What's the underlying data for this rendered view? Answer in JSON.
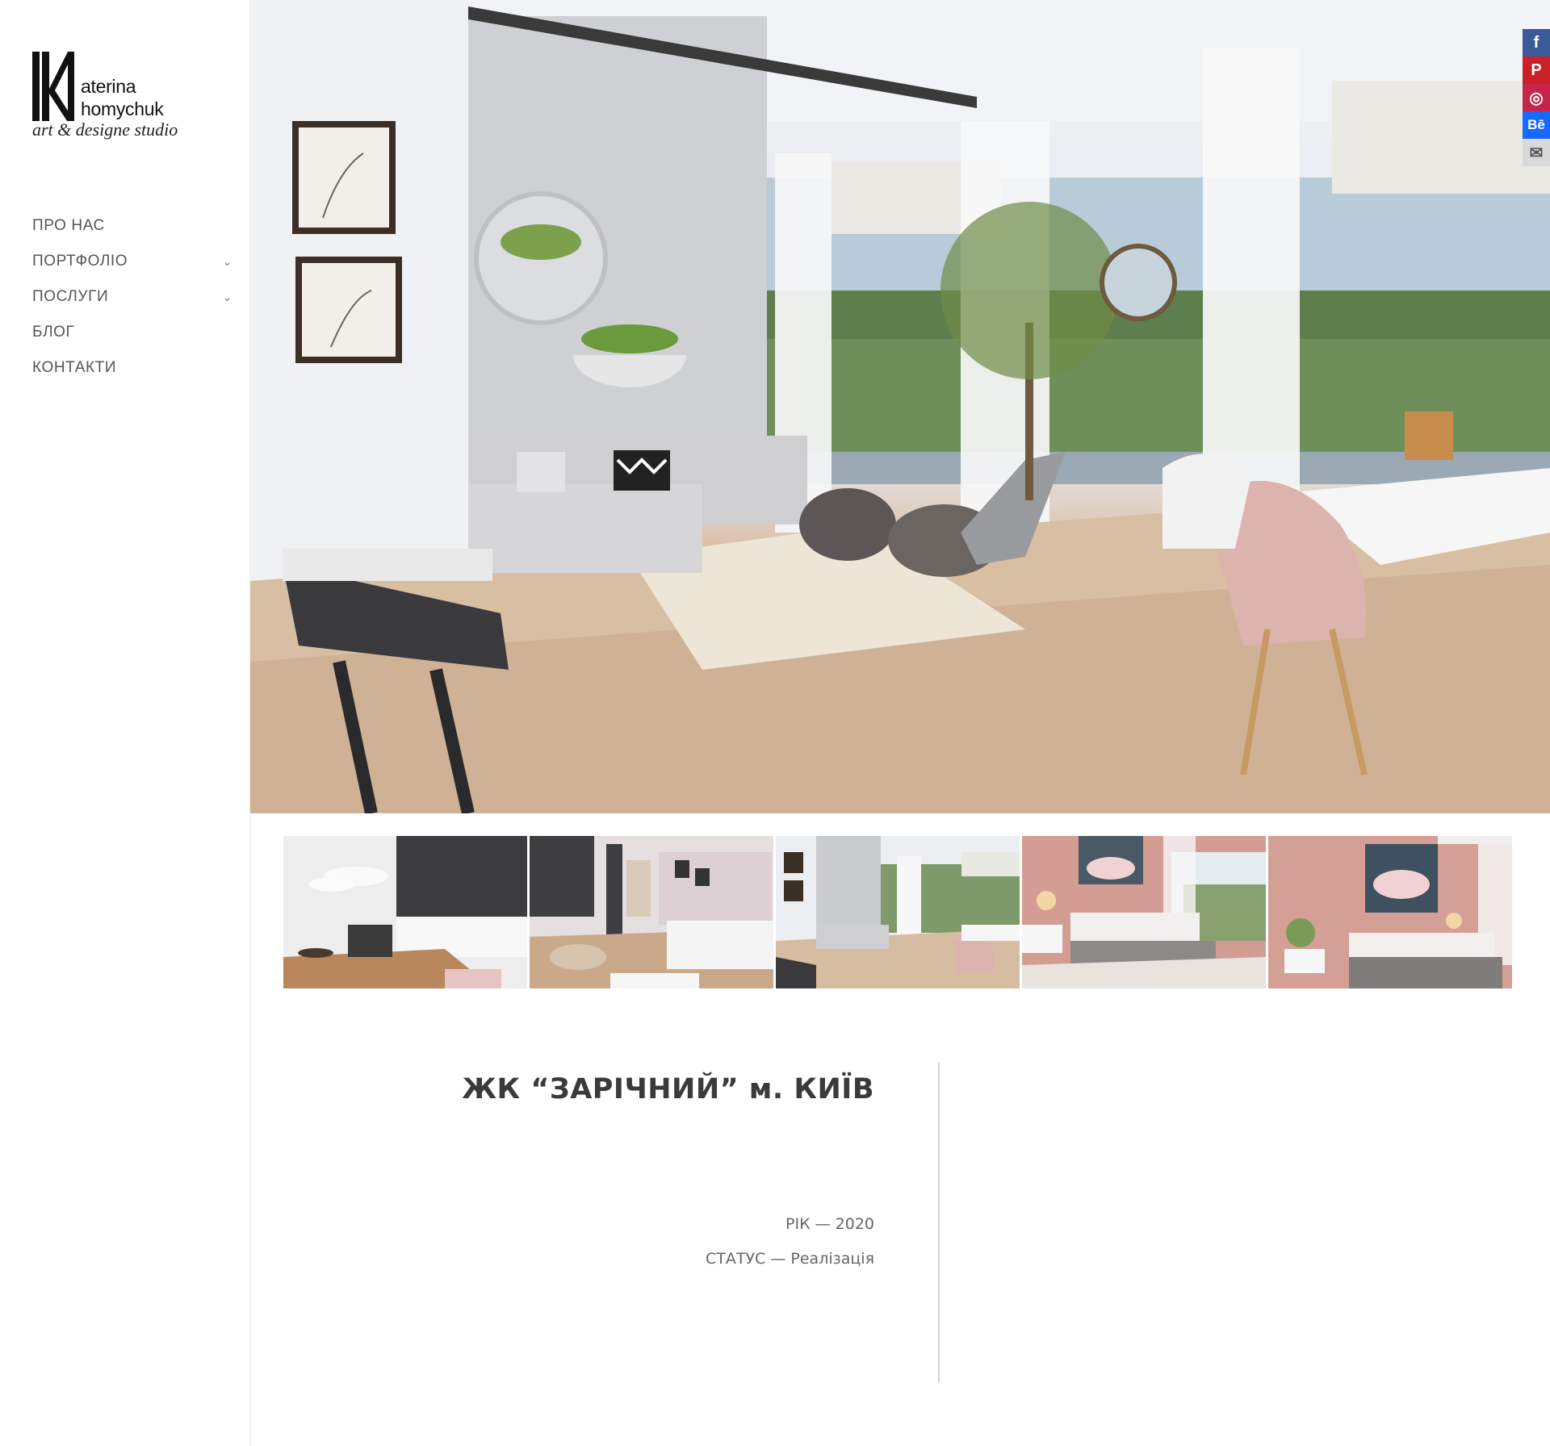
{
  "logo": {
    "line1": "aterina",
    "line2": "homychuk",
    "tagline": "art & designe studio"
  },
  "nav": {
    "items": [
      {
        "label": "ПРО НАС",
        "has_submenu": false
      },
      {
        "label": "ПОРТФОЛІО",
        "has_submenu": true
      },
      {
        "label": "ПОСЛУГИ",
        "has_submenu": true
      },
      {
        "label": "БЛОГ",
        "has_submenu": false
      },
      {
        "label": "КОНТАКТИ",
        "has_submenu": false
      }
    ],
    "chevron": "⌄"
  },
  "social": [
    {
      "icon": "facebook-icon",
      "glyph": "f",
      "color": "#3b5998"
    },
    {
      "icon": "pinterest-icon",
      "glyph": "P",
      "color": "#cb2027"
    },
    {
      "icon": "instagram-icon",
      "glyph": "◎",
      "color": "#c5254b"
    },
    {
      "icon": "behance-icon",
      "glyph": "Bē",
      "color": "#1769ff"
    },
    {
      "icon": "email-icon",
      "glyph": "✉",
      "color": "#cfcfcf"
    }
  ],
  "gallery": {
    "hero_image": "living room with dining area",
    "thumbnails": [
      "kitchen with laptop",
      "living room with white sofa",
      "living and dining room",
      "pink bedroom",
      "pink bedroom detail"
    ]
  },
  "project": {
    "title": "ЖК  “ЗАРІЧНИЙ” м. КИЇВ",
    "year": "РІК — 2020",
    "status": "СТАТУС — Реалізація"
  }
}
